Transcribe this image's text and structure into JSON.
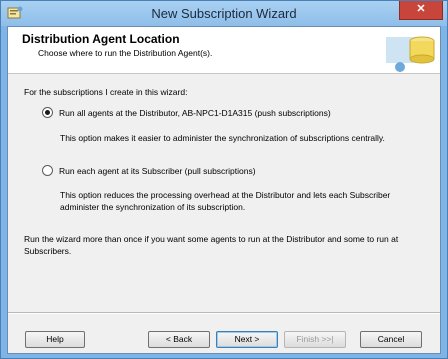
{
  "window": {
    "title": "New Subscription Wizard",
    "close_label": "✕"
  },
  "header": {
    "title": "Distribution Agent Location",
    "subtitle": "Choose where to run the Distribution Agent(s)."
  },
  "content": {
    "intro": "For the subscriptions I create in this wizard:",
    "options": [
      {
        "label": "Run all agents at the Distributor, AB-NPC1-D1A315 (push subscriptions)",
        "checked": true,
        "description": "This option makes it easier to administer the synchronization of subscriptions centrally."
      },
      {
        "label": "Run each agent at its Subscriber (pull subscriptions)",
        "checked": false,
        "description": "This option reduces the processing overhead at the Distributor and lets each Subscriber administer the synchronization of its subscription."
      }
    ],
    "note": "Run the wizard more than once if you want some agents to run at the Distributor and some to run at Subscribers."
  },
  "buttons": {
    "help": "Help",
    "back": "< Back",
    "next": "Next >",
    "finish": "Finish >>|",
    "cancel": "Cancel"
  },
  "colors": {
    "title_bar": "#8ebee9",
    "close_button": "#c7453a",
    "dialog_background": "#f0f0f0"
  }
}
